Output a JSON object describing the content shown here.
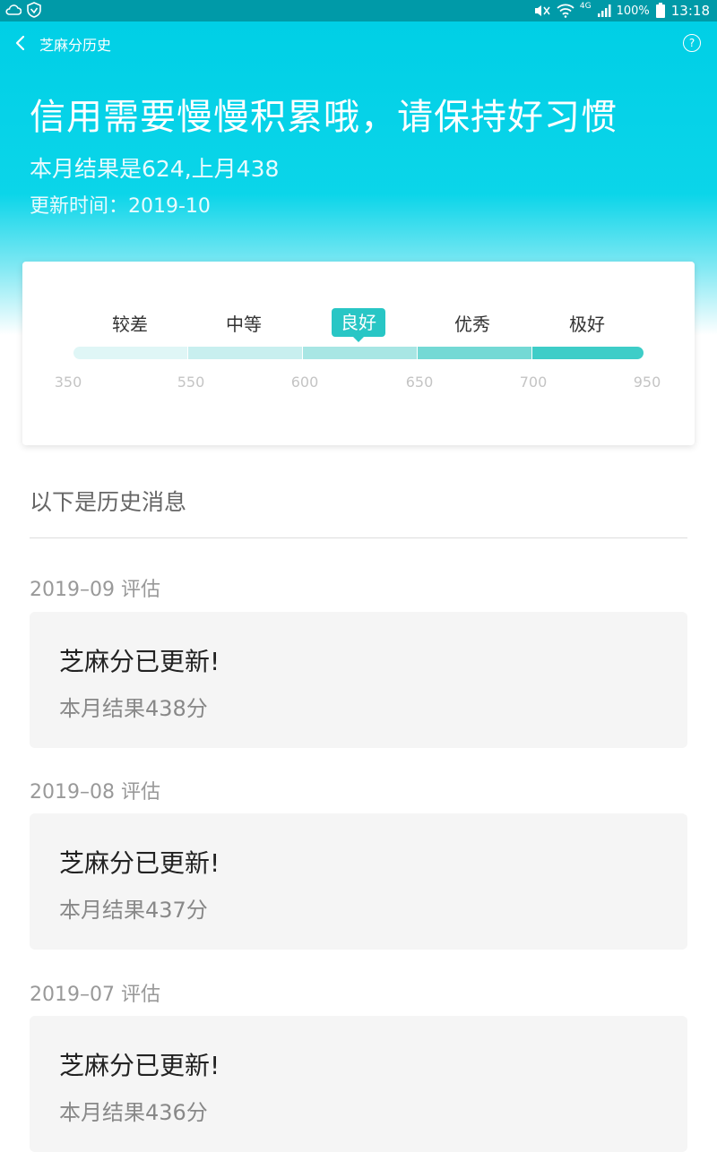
{
  "status_bar": {
    "battery": "100%",
    "network": "4G",
    "time": "13:18"
  },
  "nav": {
    "title": "芝麻分历史",
    "help_glyph": "?"
  },
  "summary": {
    "headline": "信用需要慢慢积累哦，请保持好习惯",
    "result": "本月结果是624,上月438",
    "update_time": "更新时间：2019-10"
  },
  "score_scale": {
    "levels": [
      "较差",
      "中等",
      "良好",
      "优秀",
      "极好"
    ],
    "active_level": "良好",
    "ticks": [
      "350",
      "550",
      "600",
      "650",
      "700",
      "950"
    ],
    "segment_colors": [
      "#dff6f6",
      "#c8efef",
      "#a8e6e4",
      "#74d9d5",
      "#3ecdc8"
    ],
    "accent_color": "#28c6c5"
  },
  "history": {
    "heading": "以下是历史消息",
    "entries": [
      {
        "date": "2019–09 评估",
        "title": "芝麻分已更新!",
        "result": "本月结果438分"
      },
      {
        "date": "2019–08 评估",
        "title": "芝麻分已更新!",
        "result": "本月结果437分"
      },
      {
        "date": "2019–07 评估",
        "title": "芝麻分已更新!",
        "result": "本月结果436分"
      }
    ]
  }
}
